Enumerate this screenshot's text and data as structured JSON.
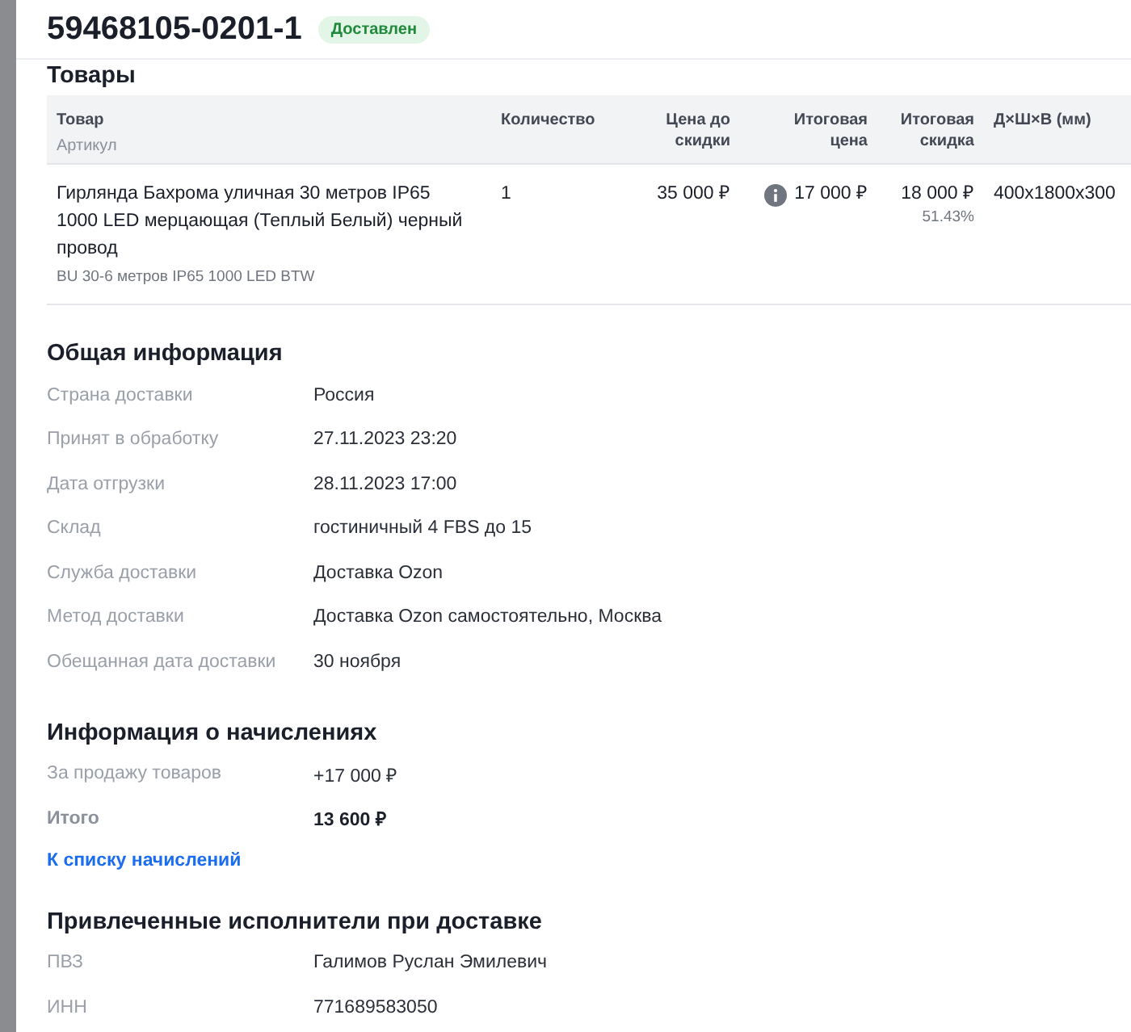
{
  "header": {
    "title": "59468105-0201-1",
    "status": "Доставлен"
  },
  "products": {
    "title": "Товары",
    "columns": [
      {
        "label": "Товар",
        "sub": "Артикул"
      },
      {
        "label": "Количество"
      },
      {
        "label": "Цена до скидки"
      },
      {
        "label": "Итоговая цена"
      },
      {
        "label": "Итоговая скидка"
      },
      {
        "label": "Д×Ш×В (мм)"
      }
    ],
    "rows": [
      {
        "name": "Гирлянда Бахрома уличная 30 метров IP65 1000 LED мерцающая (Теплый Белый) черный провод",
        "article": "BU 30-6 метров IP65 1000 LED BTW",
        "quantity": "1",
        "price_before": "35 000 ₽",
        "final_price": "17 000 ₽",
        "discount": "18 000 ₽",
        "discount_percent": "51.43%",
        "dimensions": "400x1800x300"
      }
    ]
  },
  "general": {
    "title": "Общая информация",
    "rows": [
      {
        "label": "Страна доставки",
        "value": "Россия"
      },
      {
        "label": "Принят в обработку",
        "value": "27.11.2023 23:20"
      },
      {
        "label": "Дата отгрузки",
        "value": "28.11.2023 17:00"
      },
      {
        "label": "Склад",
        "value": "гостиничный 4 FBS до 15"
      },
      {
        "label": "Служба доставки",
        "value": "Доставка Ozon"
      },
      {
        "label": "Метод доставки",
        "value": "Доставка Ozon самостоятельно, Москва"
      },
      {
        "label": "Обещанная дата доставки",
        "value": "30 ноября"
      }
    ]
  },
  "accruals": {
    "title": "Информация о начислениях",
    "rows": [
      {
        "label": "За продажу товаров",
        "value": "+17 000 ₽",
        "kind": "normal"
      },
      {
        "label": "Итого",
        "value": "13 600 ₽",
        "kind": "total"
      }
    ],
    "link": "К списку начислений"
  },
  "contractors": {
    "title": "Привлеченные исполнители при доставке",
    "rows": [
      {
        "label": "ПВЗ",
        "value": "Галимов Руслан Эмилевич"
      },
      {
        "label": "ИНН",
        "value": "771689583050"
      }
    ]
  }
}
